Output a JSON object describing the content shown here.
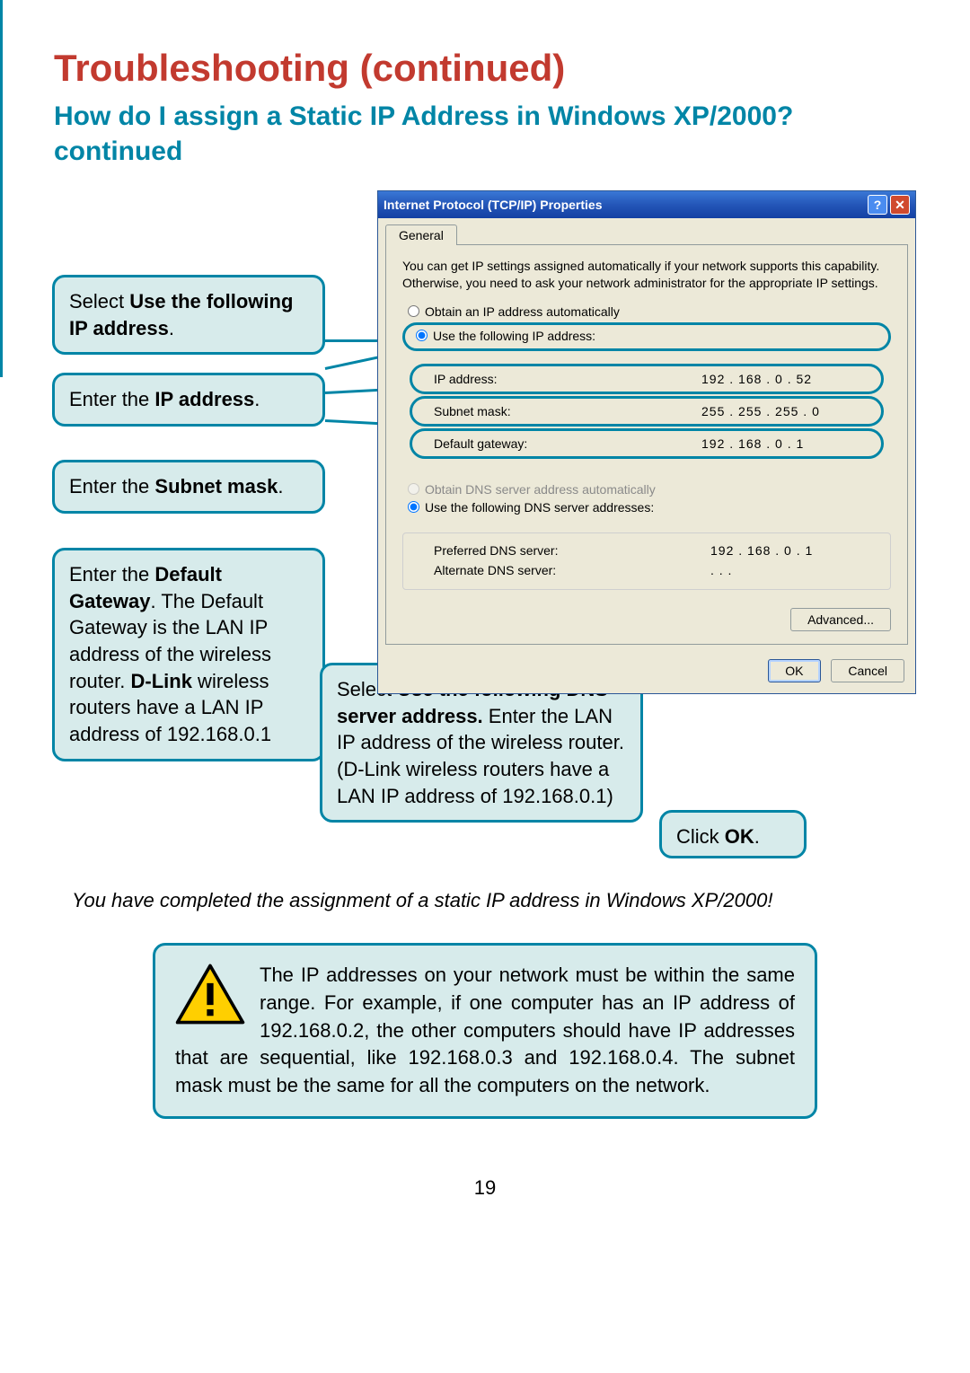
{
  "page_title": "Troubleshooting (continued)",
  "subtitle": "How do I assign a Static IP Address in Windows XP/2000? continued",
  "callouts": {
    "c1_pre": "Select ",
    "c1_bold": "Use the following IP address",
    "c1_post": ".",
    "c2_pre": "Enter the ",
    "c2_bold": "IP address",
    "c2_post": ".",
    "c3_pre": "Enter the ",
    "c3_bold": "Subnet mask",
    "c3_post": ".",
    "c4_pre": "Enter the ",
    "c4_bold": "Default Gateway",
    "c4_mid": ". The Default Gateway is the LAN IP address of the wireless router. ",
    "c4_bold2": "D-Link",
    "c4_post": " wireless routers have a  LAN IP address of 192.168.0.1",
    "c5_pre": "Select ",
    "c5_bold": "Use the following DNS server address.",
    "c5_post": " Enter the LAN IP address of the wireless router. (D-Link wireless routers have a LAN IP address of 192.168.0.1)",
    "c6_pre": "Click ",
    "c6_bold": "OK",
    "c6_post": "."
  },
  "dialog": {
    "title": "Internet Protocol (TCP/IP) Properties",
    "help_glyph": "?",
    "close_glyph": "✕",
    "tab_general": "General",
    "description": "You can get IP settings assigned automatically if your network supports this capability. Otherwise, you need to ask your network administrator for the appropriate IP settings.",
    "radio_obtain_ip": "Obtain an IP address automatically",
    "radio_use_ip": "Use the following IP address:",
    "ip_label": "IP address:",
    "ip_value": "192 . 168 .   0  .  52",
    "subnet_label": "Subnet mask:",
    "subnet_value": "255 . 255 . 255 .   0",
    "gateway_label": "Default gateway:",
    "gateway_value": "192 . 168 .   0  .   1",
    "radio_obtain_dns": "Obtain DNS server address automatically",
    "radio_use_dns": "Use the following DNS server addresses:",
    "pref_dns_label": "Preferred DNS server:",
    "pref_dns_value": "192 . 168 .   0  .   1",
    "alt_dns_label": "Alternate DNS server:",
    "alt_dns_value": ".        .        .",
    "advanced_btn": "Advanced...",
    "ok_btn": "OK",
    "cancel_btn": "Cancel"
  },
  "completion_text": "You have completed the assignment of a static IP address in Windows XP/2000!",
  "note_text": "The IP addresses on your network must be within the same range. For example, if one computer has an IP address of 192.168.0.2, the other computers should have IP addresses that are sequential, like 192.168.0.3 and 192.168.0.4. The subnet mask must be the same for all the computers on the network.",
  "page_number": "19"
}
